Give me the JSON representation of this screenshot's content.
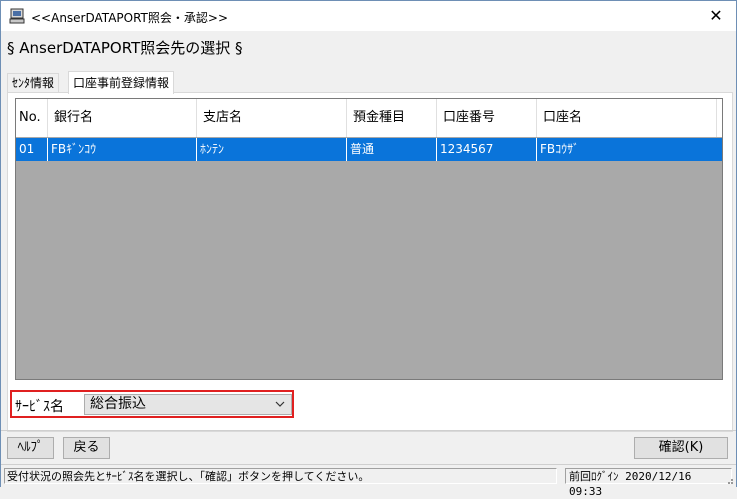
{
  "window": {
    "title": "<<AnserDATAPORT照会・承認>>",
    "close_glyph": "✕"
  },
  "heading": "§ AnserDATAPORT照会先の選択 §",
  "tabs": [
    {
      "label": "ｾﾝﾀ情報"
    },
    {
      "label": "口座事前登録情報"
    }
  ],
  "table": {
    "headers": [
      "No.",
      "銀行名",
      "支店名",
      "預金種目",
      "口座番号",
      "口座名"
    ],
    "rows": [
      {
        "no": "01",
        "bank": "FBｷﾞﾝｺｳ",
        "branch": "ﾎﾝﾃﾝ",
        "type": "普通",
        "number": "1234567",
        "name": "FBｺｳｻﾞ"
      }
    ]
  },
  "service": {
    "label": "ｻｰﾋﾞｽ名",
    "value": "総合振込"
  },
  "buttons": {
    "help": "ﾍﾙﾌﾟ",
    "back": "戻る",
    "confirm": "確認(K)"
  },
  "status": {
    "message": "受付状況の照会先とｻｰﾋﾞｽ名を選択し、「確認」ボタンを押してください。",
    "last_login": "前回ﾛｸﾞｲﾝ 2020/12/16 09:33"
  }
}
